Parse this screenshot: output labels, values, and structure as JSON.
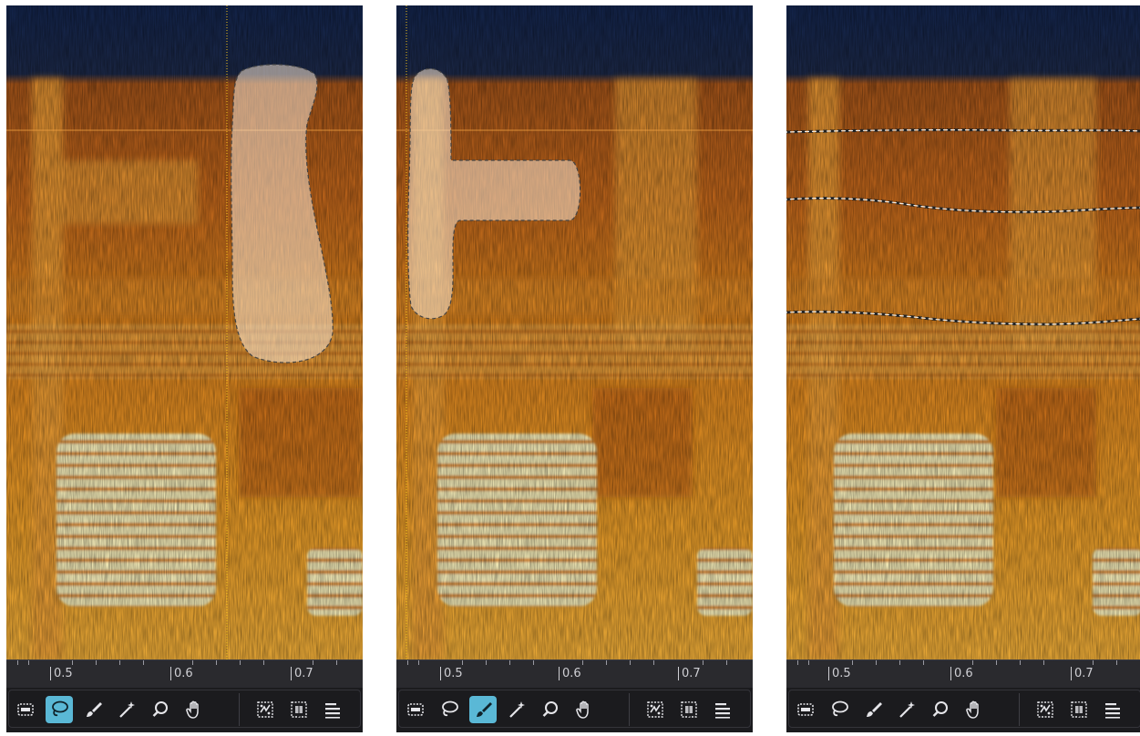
{
  "panels": [
    {
      "id": "panel-1",
      "active_tool": "lasso-selection",
      "selection": "lasso",
      "ruler": {
        "labels": [
          "0.5",
          "0.6",
          "0.7"
        ]
      }
    },
    {
      "id": "panel-2",
      "active_tool": "brush-selection",
      "selection": "brush",
      "ruler": {
        "labels": [
          "0.5",
          "0.6",
          "0.7"
        ]
      }
    },
    {
      "id": "panel-3",
      "active_tool": "none",
      "selection": "harmonic-bands",
      "ruler": {
        "labels": [
          "0.5",
          "0.6",
          "0.7"
        ]
      }
    }
  ],
  "tools": [
    {
      "name": "time-frequency-selection",
      "icon": "rect-select-icon"
    },
    {
      "name": "lasso-selection",
      "icon": "lasso-icon"
    },
    {
      "name": "brush-selection",
      "icon": "brush-icon"
    },
    {
      "name": "magic-wand-selection",
      "icon": "magic-wand-icon"
    },
    {
      "name": "zoom",
      "icon": "magnifier-icon"
    },
    {
      "name": "grab-scroll",
      "icon": "hand-icon"
    },
    {
      "name": "find-similar-event",
      "icon": "find-similar-icon"
    },
    {
      "name": "find-similar-selection",
      "icon": "find-similar-selection-icon"
    },
    {
      "name": "toggle-list",
      "icon": "list-icon"
    }
  ],
  "colors": {
    "accent": "#5ab8d6",
    "background": "#1b1b1e",
    "ruler": "#2a2a2e",
    "noise_floor": "#13234a",
    "spectrogram_mid": "#d4781c",
    "spectrogram_hot": "#fff3b0",
    "playhead": "#f5c518"
  }
}
